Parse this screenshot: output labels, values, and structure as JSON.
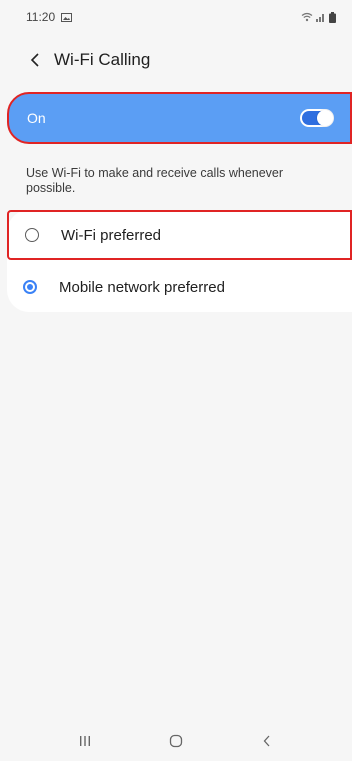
{
  "status_bar": {
    "time": "11:20",
    "left_icons": [
      "gallery-icon"
    ],
    "right_icons": [
      "wifi-icon",
      "signal-icon",
      "battery-icon"
    ]
  },
  "header": {
    "title": "Wi-Fi Calling",
    "back_icon": "back-arrow-icon"
  },
  "master_switch": {
    "label": "On",
    "state": "on"
  },
  "description": "Use Wi-Fi to make and receive calls whenever possible.",
  "options": [
    {
      "label": "Wi-Fi preferred",
      "selected": false
    },
    {
      "label": "Mobile network preferred",
      "selected": true
    }
  ],
  "nav_bar": {
    "buttons": [
      "recent-apps-icon",
      "home-icon",
      "back-icon"
    ]
  },
  "colors": {
    "accent": "#5b9ef4",
    "switch_track": "#2f6fe0",
    "radio_selected": "#3b82f6",
    "highlight_border": "#e02424",
    "background": "#f6f6f6"
  }
}
